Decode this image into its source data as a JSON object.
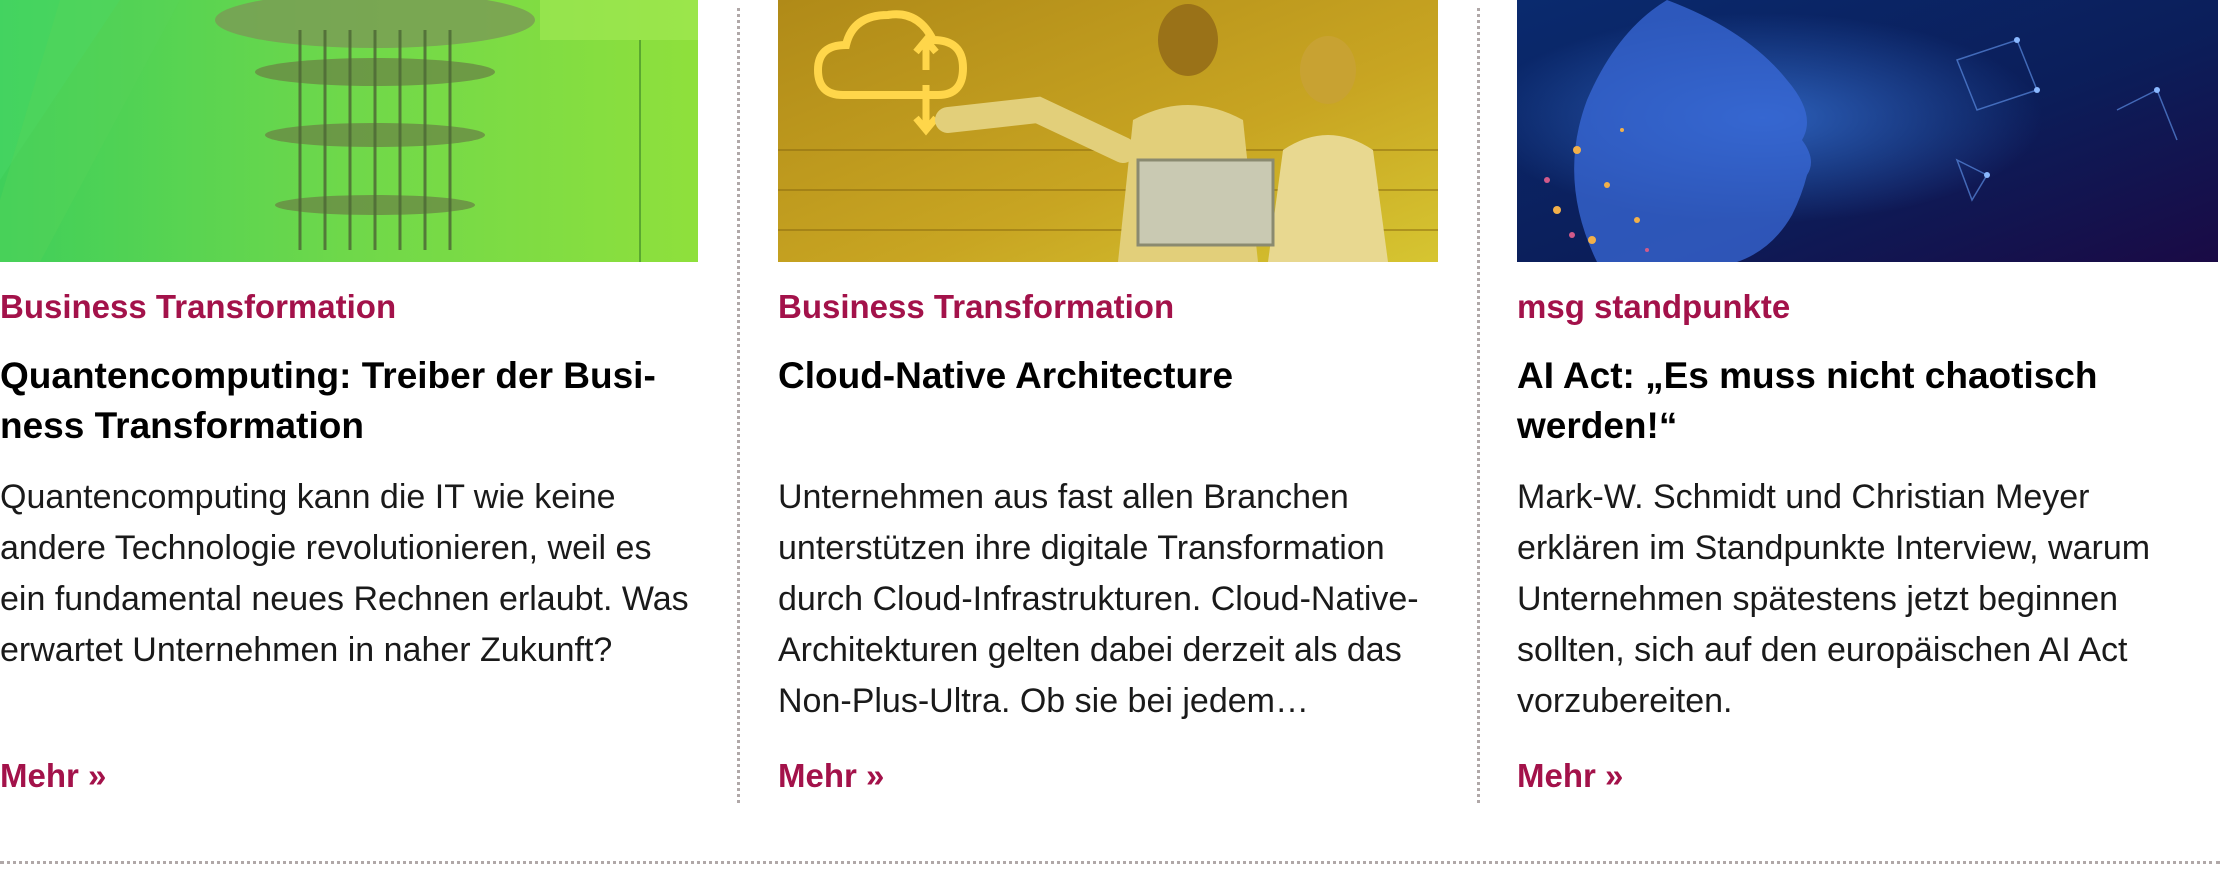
{
  "teasers": [
    {
      "image_alt": "Quantum computer",
      "category": "Business Transformation",
      "headline_line1": "Quantencomputing: Treiber der Busi-",
      "headline_line2": "ness Transformation",
      "teaser": "Quantencomputing kann die IT wie keine andere Technologie revolutionieren, weil es ein fundamental neues Rechnen erlaubt. Was erwartet Unternehmen in naher Zukunft?",
      "more_label": "Mehr »"
    },
    {
      "image_alt": "Cloud architecture team",
      "category": "Business Transformation",
      "headline_line1": "Cloud-Native Architecture",
      "headline_line2": "",
      "teaser": "Unternehmen aus fast allen Branchen unterstützen ihre digitale Transformation durch Cloud-Infrastrukturen. Cloud-Native-Architekturen gelten dabei derzeit als das Non-Plus-Ultra. Ob sie bei jedem…",
      "more_label": "Mehr »"
    },
    {
      "image_alt": "AI digital face",
      "category": "msg standpunkte",
      "headline_line1": "AI Act: „Es muss nicht chaotisch",
      "headline_line2": "werden!“",
      "teaser": "Mark-W. Schmidt und Christian Meyer erklären im Standpunkte Interview, warum Unternehmen spätestens jetzt beginnen sollten, sich auf den europäischen AI Act vorzubereiten.",
      "more_label": "Mehr »"
    }
  ],
  "colors": {
    "accent": "#a3124a",
    "headline": "#000000",
    "divider": "#b0a8a8"
  }
}
